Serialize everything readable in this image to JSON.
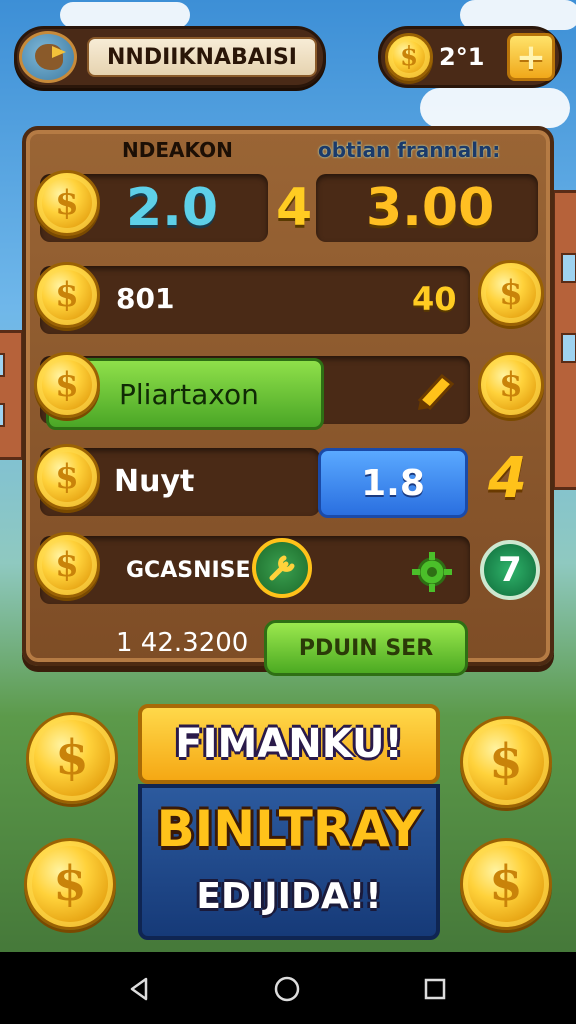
{
  "header": {
    "player_name": "NNDIIKNABAISI",
    "balance": "2°1",
    "add_label": "+"
  },
  "board": {
    "header_left": "NDEAKON",
    "header_right": "obtian frannaln:",
    "row1": {
      "value_a": "2.0",
      "mid": "4",
      "value_b": "3.00"
    },
    "row2": {
      "label": "801",
      "value": "40"
    },
    "row3": {
      "label": "Pliartaxon",
      "icon": "pencil-icon"
    },
    "row4": {
      "label": "Nuyt",
      "value": "1.8",
      "icon": "4"
    },
    "row5": {
      "label": "GCASNISE",
      "badge": "7"
    },
    "footer": {
      "amount": "1 42.3200",
      "button": "PDUIN SER"
    }
  },
  "banner": {
    "top": "FIMANKU!",
    "big": "BINLTRAY",
    "small": "EDIJIDA!!"
  },
  "coin_symbol": "$",
  "colors": {
    "green": "#4aa626",
    "blue": "#2a6fe0",
    "gold": "#ffc21a",
    "wood": "#7e4d26"
  }
}
